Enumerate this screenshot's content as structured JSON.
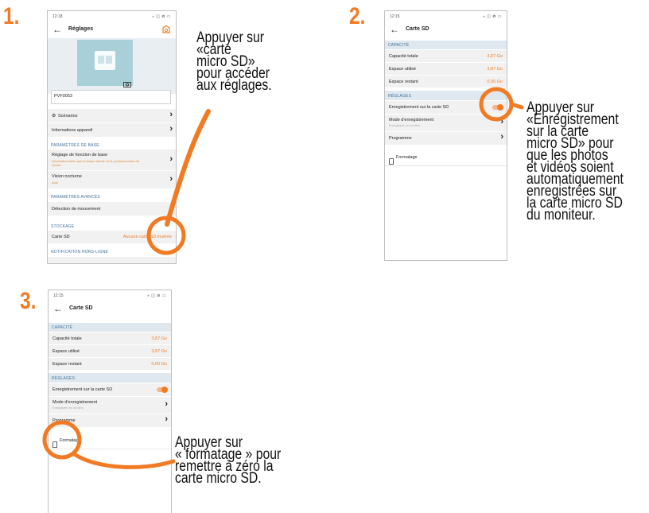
{
  "colors": {
    "accent": "#f07b24",
    "section_bg": "#dfe8ee",
    "section_text": "#3d6f9a",
    "row_bg": "#f1f1f1"
  },
  "steps": [
    {
      "number": "1.",
      "instruction": "Appuyer sur\n«carte\nmicro SD»\npour accéder\naux réglages.",
      "screen": {
        "status_time": "12:18",
        "status_right": "⁎ ◫ ⋒ ▭",
        "back_icon": "arrow-left-icon",
        "title": "Réglages",
        "header_icon": "camera-box-icon",
        "device_name": "PVF0053",
        "rows_top": [
          {
            "label": "Scénarios",
            "icon": "scenario-icon"
          },
          {
            "label": "Informations appareil"
          }
        ],
        "section_base": "PARAMÈTRES DE BASE",
        "base_rows": [
          {
            "label": "Réglage de fonction de base",
            "sub": "Information telles que la lampe témoin et le positionnement de l'écran"
          },
          {
            "label": "Vision nocturne",
            "sub": "Auto"
          }
        ],
        "section_advanced": "PARAMÈTRES AVANCÉS",
        "advanced_rows": [
          {
            "label": "Détection de mouvement"
          }
        ],
        "section_storage": "STOCKAGE",
        "storage_row": {
          "label": "Carte SD",
          "value": "Aucune carte SD insérée"
        },
        "section_offline": "NOTIFICATION HORS-LIGNE"
      }
    },
    {
      "number": "2.",
      "instruction": "Appuyer sur\n«Enregistrement\nsur la carte\nmicro SD» pour\nque les photos\net vidéos soient\nautomatiquement\nenregistrées sur\nla carte micro SD\ndu moniteur.",
      "screen": {
        "status_time": "12:15",
        "status_right": "⁎ ◫ ⋒ ▭",
        "title": "Carte SD",
        "section_capacity": "CAPACITÉ",
        "capacity_rows": [
          {
            "label": "Capacité totale",
            "value": "3,87 Go"
          },
          {
            "label": "Espace utilisé",
            "value": "3,87 Go"
          },
          {
            "label": "Espace restant",
            "value": "0,00 Go"
          }
        ],
        "section_settings": "RÉGLAGES",
        "toggle_row": "Enregistrement sur la carte SD",
        "mode_row": {
          "label": "Mode d'enregistrement",
          "sub": "Enregistrer en continu"
        },
        "program_row": "Programme",
        "format_row": "Formatage"
      }
    },
    {
      "number": "3.",
      "instruction": "Appuyer sur\n« formatage » pour\nremettre à zéro la\ncarte micro SD.",
      "screen": {
        "status_time": "12:15",
        "status_right": "⁎ ◫ ⋒ ▭",
        "title": "Carte SD",
        "section_capacity": "CAPACITÉ",
        "capacity_rows": [
          {
            "label": "Capacité totale",
            "value": "3,87 Go"
          },
          {
            "label": "Espace utilisé",
            "value": "3,87 Go"
          },
          {
            "label": "Espace restant",
            "value": "0,00 Go"
          }
        ],
        "section_settings": "RÉGLAGES",
        "toggle_row": "Enregistrement sur la carte SD",
        "mode_row": {
          "label": "Mode d'enregistrement",
          "sub": "Enregistrer en continu"
        },
        "program_row": "Programme",
        "format_row": "Formatage"
      }
    }
  ]
}
